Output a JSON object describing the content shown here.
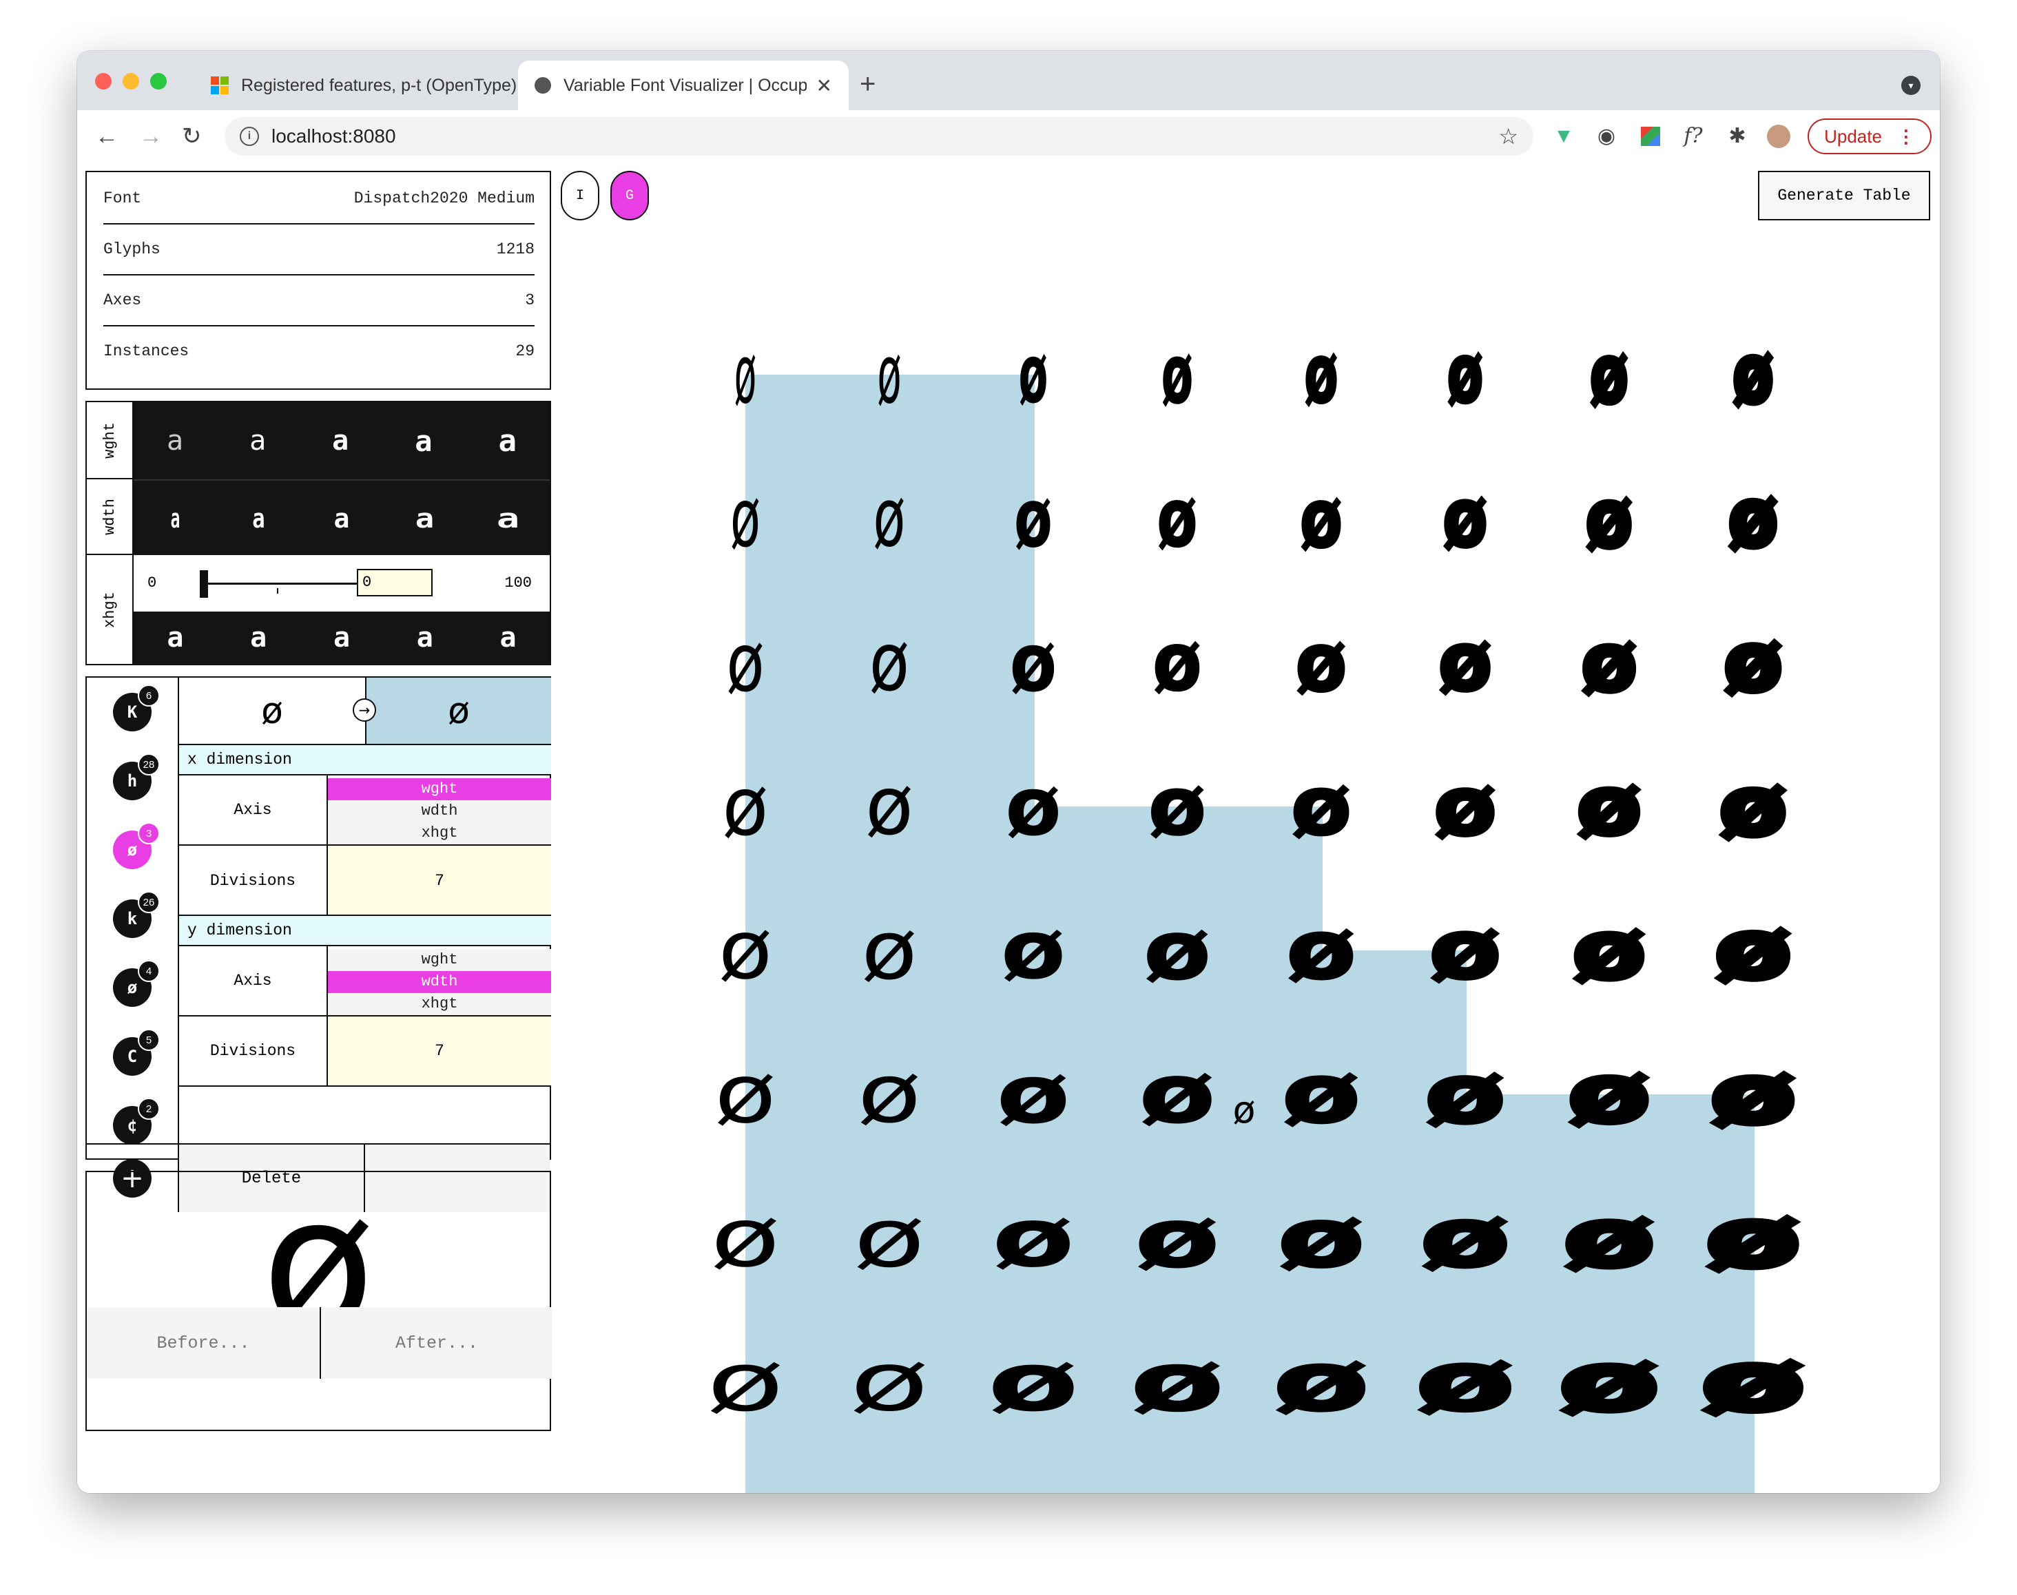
{
  "browser": {
    "tabs": [
      {
        "title": "Registered features, p-t (OpenType)",
        "active": false
      },
      {
        "title": "Variable Font Visualizer | Occupant Fonts",
        "active": true
      }
    ],
    "new_tab": "+",
    "url": "localhost:8080",
    "update_label": "Update",
    "ext_f_label": "f?"
  },
  "info": {
    "rows": [
      {
        "label": "Font",
        "value": "Dispatch2020 Medium"
      },
      {
        "label": "Glyphs",
        "value": "1218"
      },
      {
        "label": "Axes",
        "value": "3"
      },
      {
        "label": "Instances",
        "value": "29"
      }
    ]
  },
  "axes": {
    "names": [
      "wght",
      "wdth",
      "xhgt"
    ],
    "sample_char": "a",
    "slider": {
      "min": "0",
      "max": "100",
      "value": "0"
    }
  },
  "glyph_list": [
    {
      "char": "K",
      "count": "6",
      "selected": false
    },
    {
      "char": "h",
      "count": "28",
      "selected": false
    },
    {
      "char": "ø",
      "count": "3",
      "selected": true
    },
    {
      "char": "k",
      "count": "26",
      "selected": false
    },
    {
      "char": "ø",
      "count": "4",
      "selected": false
    },
    {
      "char": "C",
      "count": "5",
      "selected": false
    },
    {
      "char": "¢",
      "count": "2",
      "selected": false
    }
  ],
  "substitution": {
    "from": "ø",
    "to": "ø",
    "arrow": "→"
  },
  "x_dimension": {
    "title": "x dimension",
    "axis_label": "Axis",
    "options": [
      "wght",
      "wdth",
      "xhgt"
    ],
    "selected": "wght",
    "divisions_label": "Divisions",
    "divisions": "7"
  },
  "y_dimension": {
    "title": "y dimension",
    "axis_label": "Axis",
    "options": [
      "wght",
      "wdth",
      "xhgt"
    ],
    "selected": "wdth",
    "divisions_label": "Divisions",
    "divisions": "7"
  },
  "actions": {
    "add": "+",
    "delete_label": "Delete"
  },
  "preview": {
    "glyph": "ø",
    "before_label": "Before...",
    "after_label": "After..."
  },
  "mode_buttons": [
    {
      "label": "I",
      "active": false
    },
    {
      "label": "G",
      "active": true
    }
  ],
  "generate_label": "Generate Table",
  "grid": {
    "glyph": "ø",
    "small_glyph": "ø",
    "cols": 8,
    "rows": 8,
    "highlight_color": "#b7d8e4",
    "highlight_cols_per_row": [
      3,
      3,
      3,
      5,
      6,
      8,
      8,
      8
    ]
  },
  "colors": {
    "accent": "#e93ee3",
    "highlight": "#b7d8e4",
    "dark": "#141414",
    "input_bg": "#fefde3",
    "header_bg": "#e4fbfd"
  }
}
